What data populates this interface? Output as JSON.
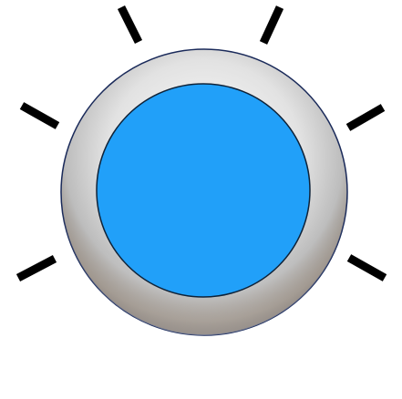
{
  "knob": {
    "icon": "rotary-knob-icon",
    "tick_count": 6,
    "colors": {
      "face": "#21A0F9",
      "bezel_light": "#E6E6E6",
      "bezel_mid": "#BDBDBD",
      "bezel_dark": "#6F6257",
      "outline": "#1A2A5A",
      "tick": "#000000",
      "background": "#FFFFFF"
    }
  }
}
